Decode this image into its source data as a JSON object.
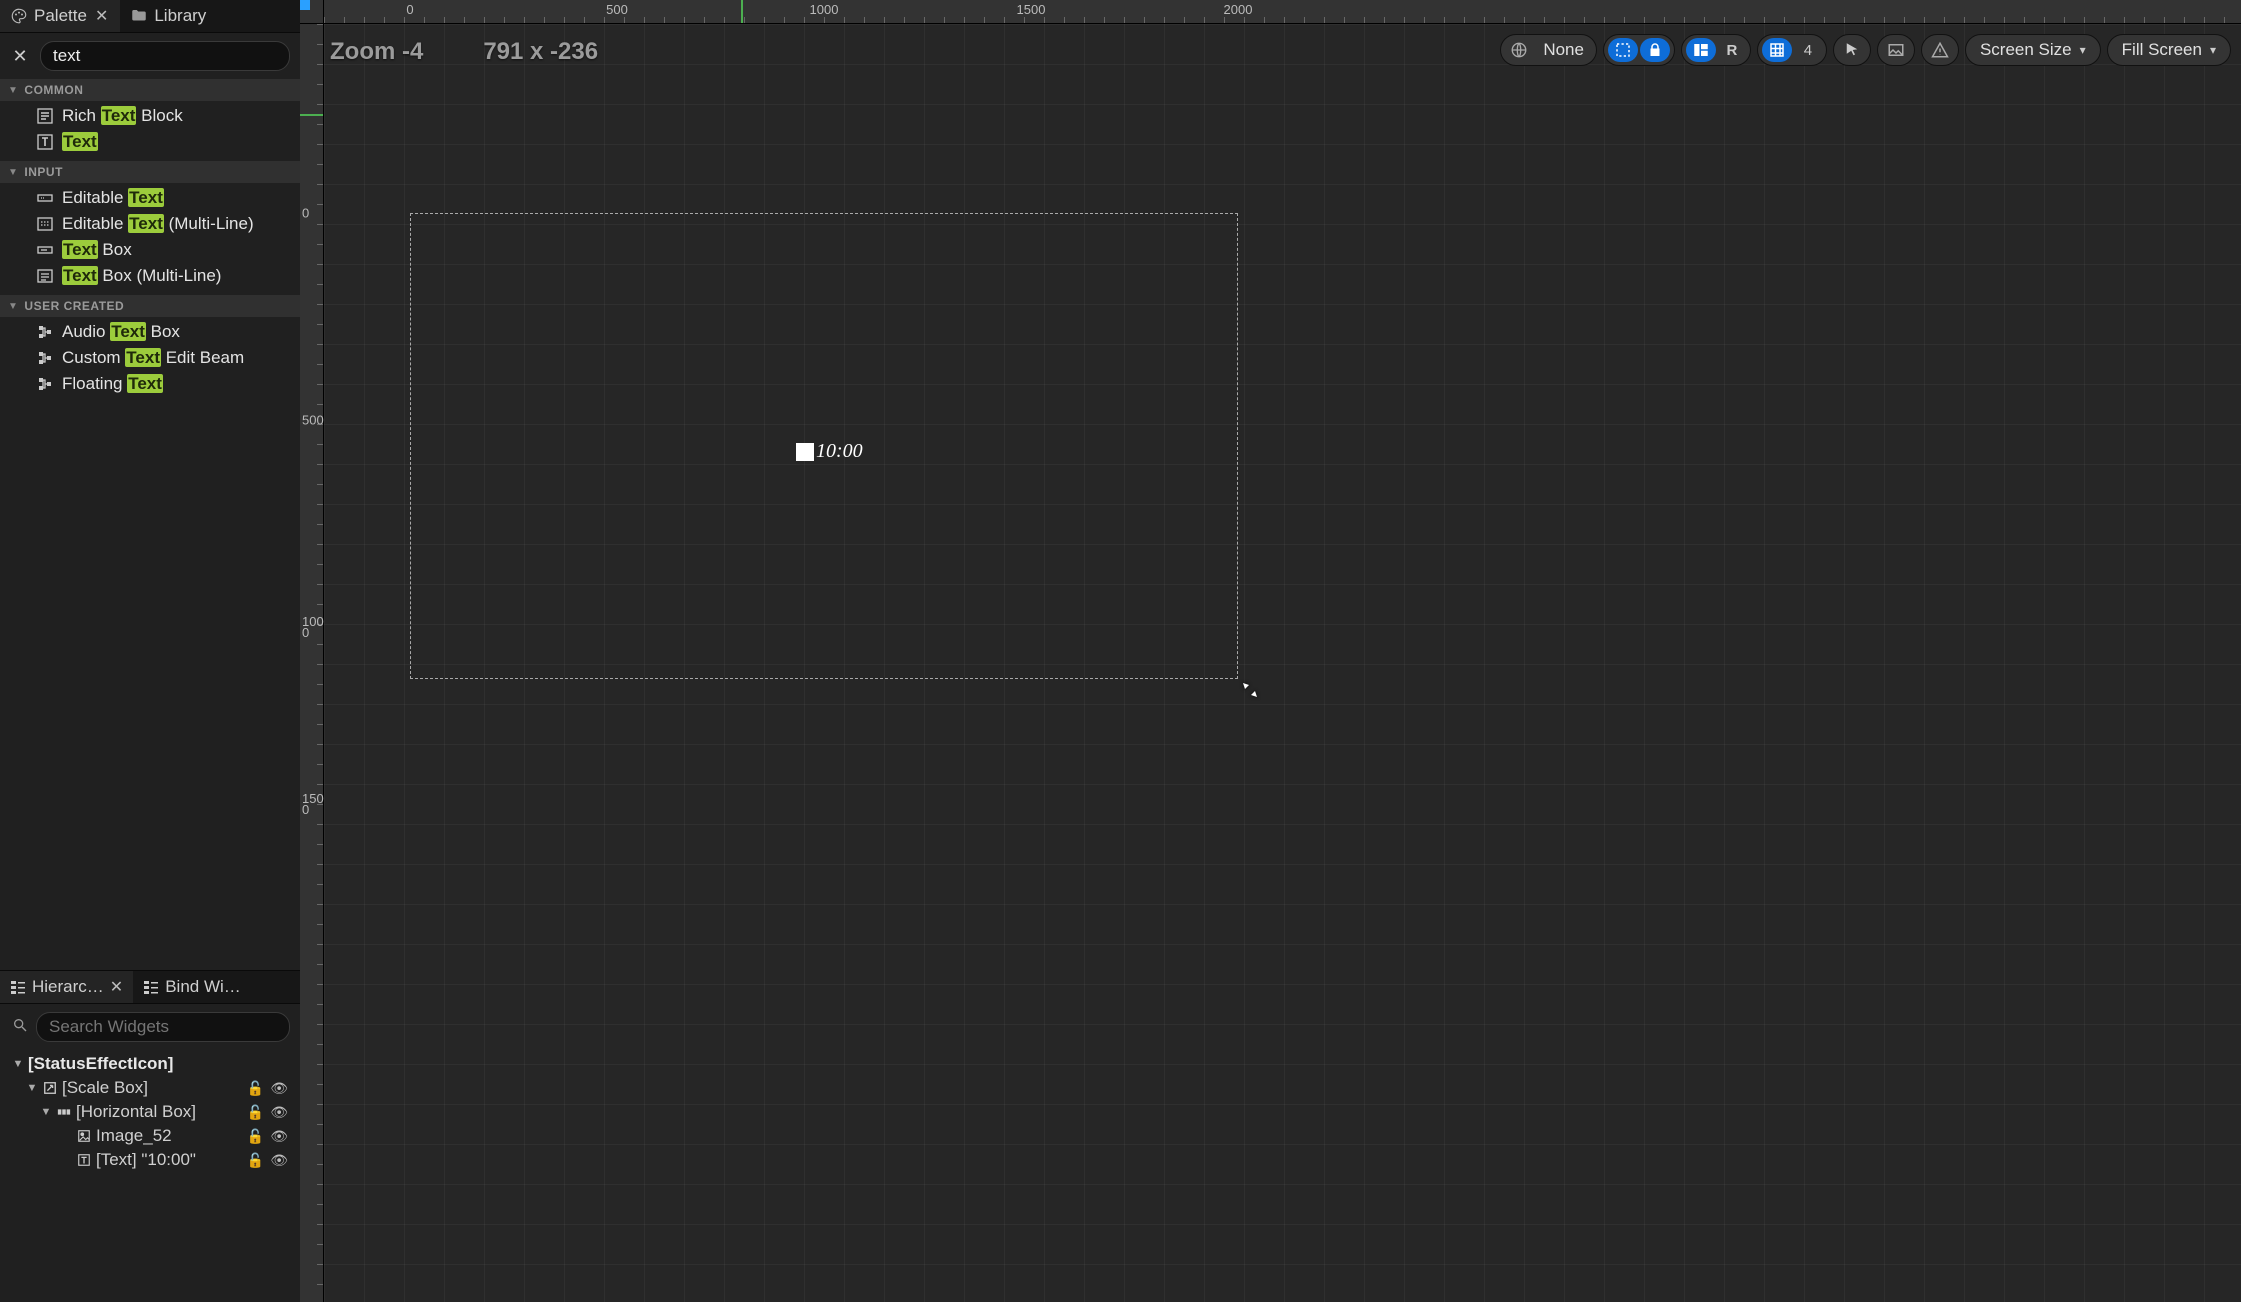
{
  "tabs": {
    "palette": "Palette",
    "library": "Library"
  },
  "search_value": "text",
  "categories": [
    {
      "title": "COMMON",
      "items": [
        {
          "pre": "Rich ",
          "hl": "Text",
          "post": " Block",
          "icon": "rich"
        },
        {
          "pre": "",
          "hl": "Text",
          "post": "",
          "icon": "text"
        }
      ]
    },
    {
      "title": "INPUT",
      "items": [
        {
          "pre": "Editable ",
          "hl": "Text",
          "post": "",
          "icon": "edit"
        },
        {
          "pre": "Editable ",
          "hl": "Text",
          "post": " (Multi-Line)",
          "icon": "edit-multi"
        },
        {
          "pre": "",
          "hl": "Text",
          "post": " Box",
          "icon": "box"
        },
        {
          "pre": "",
          "hl": "Text",
          "post": " Box (Multi-Line)",
          "icon": "box-multi"
        }
      ]
    },
    {
      "title": "USER CREATED",
      "items": [
        {
          "pre": "Audio ",
          "hl": "Text",
          "post": " Box",
          "icon": "user"
        },
        {
          "pre": "Custom ",
          "hl": "Text",
          "post": " Edit Beam",
          "icon": "user"
        },
        {
          "pre": "Floating ",
          "hl": "Text",
          "post": "",
          "icon": "user"
        }
      ]
    }
  ],
  "hierarchy_tabs": {
    "hierarchy": "Hierarc…",
    "bind": "Bind Wi…"
  },
  "hierarchy_search_placeholder": "Search Widgets",
  "tree": {
    "root": "[StatusEffectIcon]",
    "scale": "[Scale Box]",
    "horizontal": "[Horizontal Box]",
    "image": "Image_52",
    "text": "[Text] \"10:00\""
  },
  "viewport": {
    "zoom_label": "Zoom -4",
    "coords_label": "791 x -236",
    "canvas_text": "10:00",
    "toolbar": {
      "none": "None",
      "r": "R",
      "grid_num": "4",
      "screen_size": "Screen Size",
      "fill_screen": "Fill Screen"
    },
    "ruler_h": [
      "0",
      "500",
      "1000",
      "1500",
      "2000"
    ],
    "ruler_v": [
      "0",
      "500",
      "1000",
      "1500"
    ]
  }
}
